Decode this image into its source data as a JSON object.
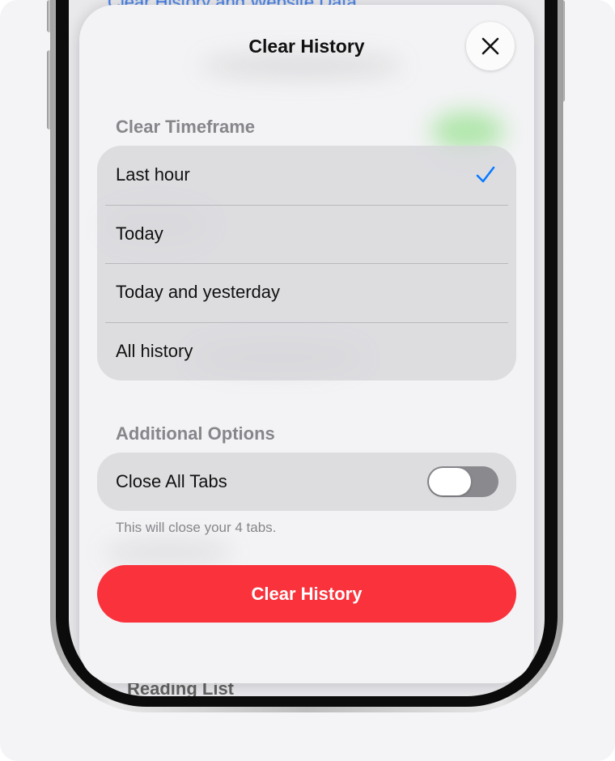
{
  "background_screen": {
    "link_text": "Clear History and Website Data",
    "bottom_text": "Reading List"
  },
  "sheet": {
    "title": "Clear History",
    "close_icon": "close-icon"
  },
  "timeframe": {
    "header": "Clear Timeframe",
    "options": [
      {
        "label": "Last hour",
        "selected": true
      },
      {
        "label": "Today",
        "selected": false
      },
      {
        "label": "Today and yesterday",
        "selected": false
      },
      {
        "label": "All history",
        "selected": false
      }
    ]
  },
  "additional_options": {
    "header": "Additional Options",
    "close_all_tabs": {
      "label": "Close All Tabs",
      "enabled": false
    },
    "footnote": "This will close your 4 tabs."
  },
  "primary_action": {
    "label": "Clear History"
  },
  "colors": {
    "accent": "#0a7aff",
    "destructive": "#f9323c",
    "toggle_off": "#8a8a8e",
    "secondary_text": "#86868b"
  }
}
